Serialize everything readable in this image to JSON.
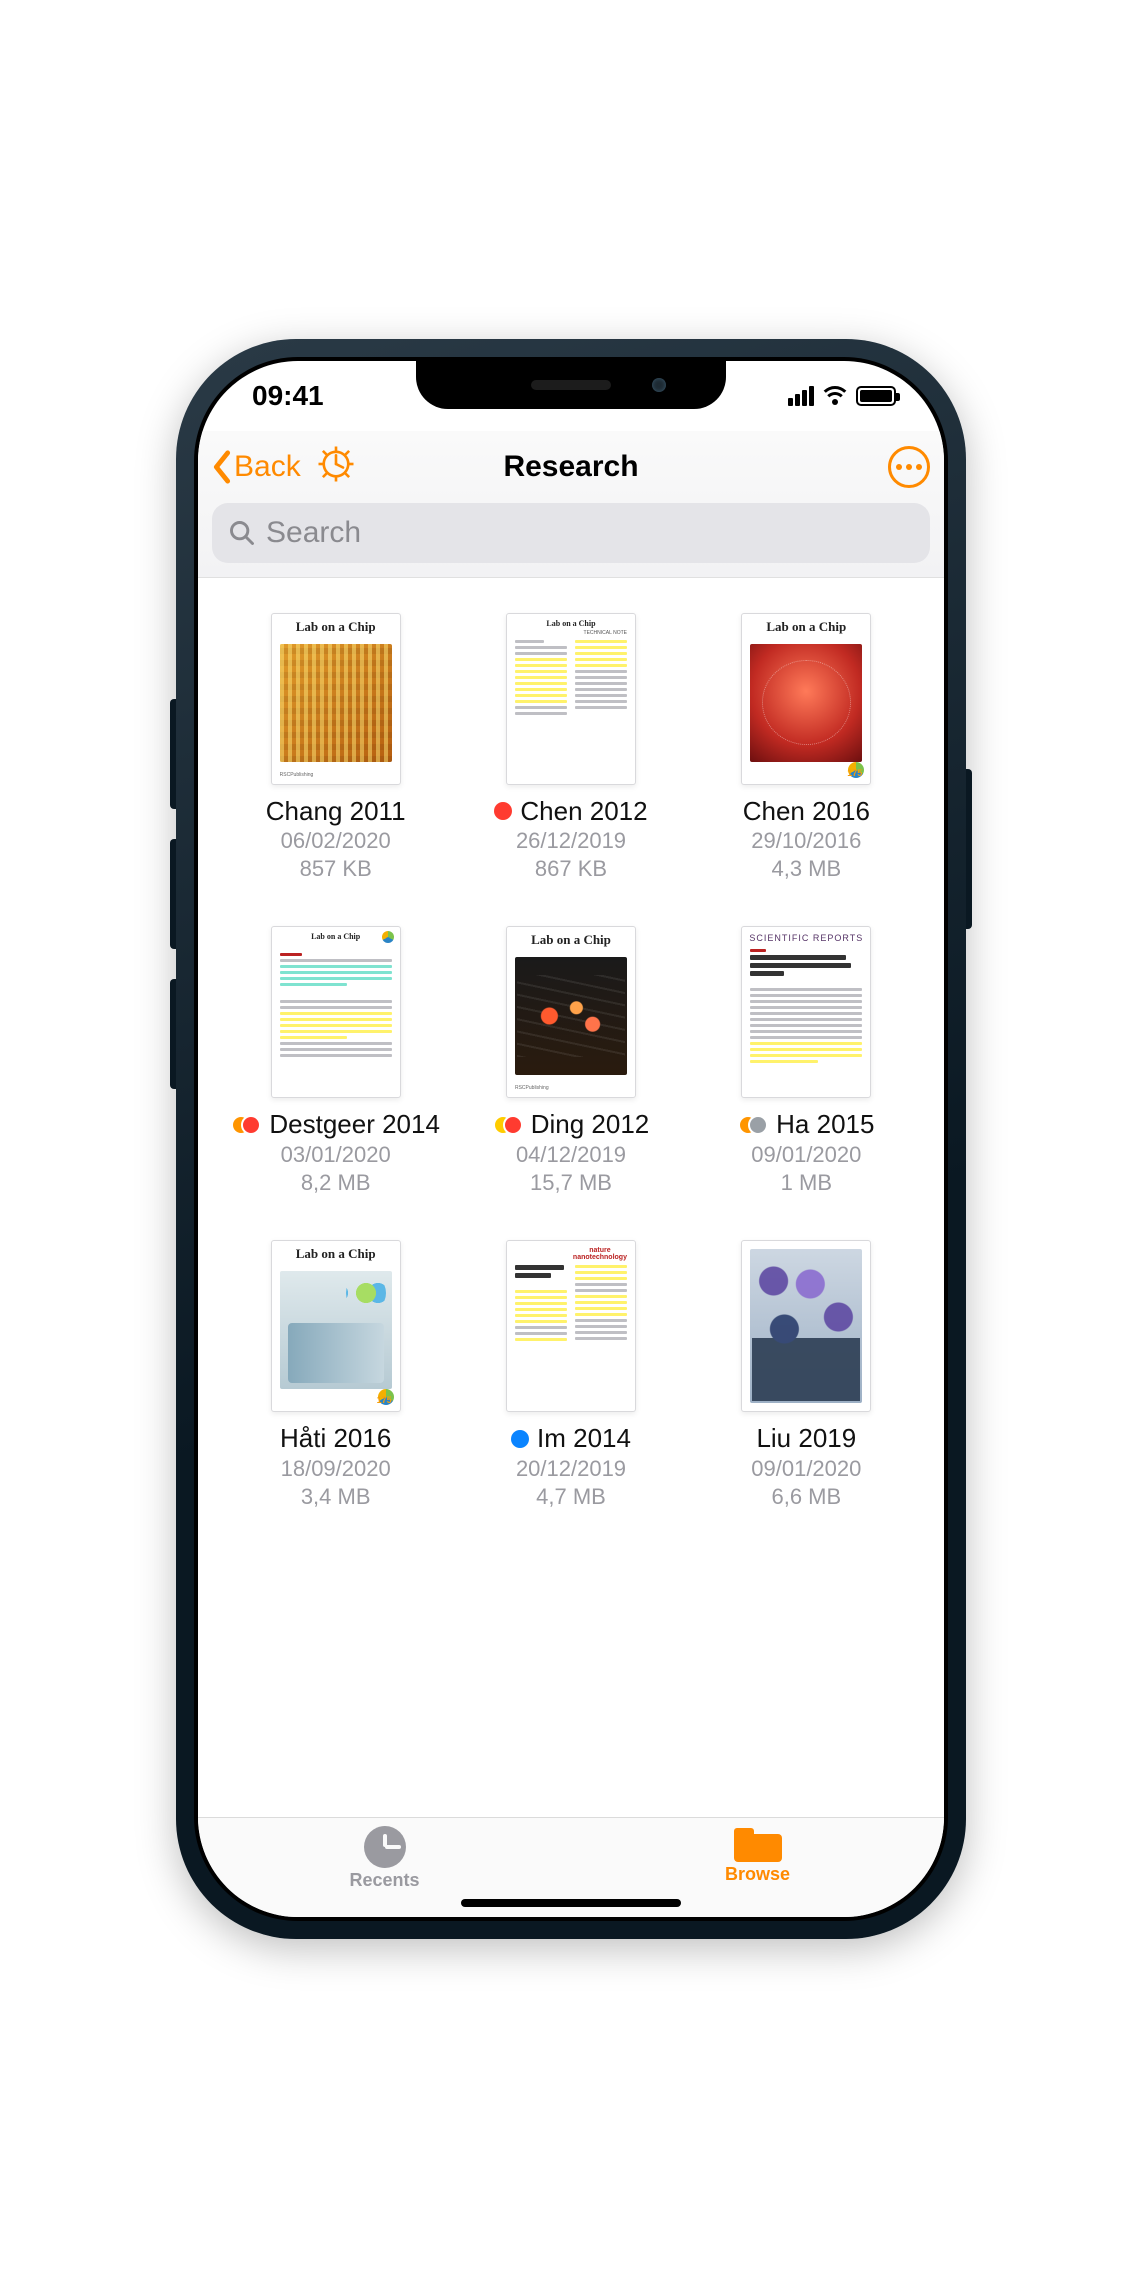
{
  "status": {
    "time": "09:41"
  },
  "nav": {
    "back_label": "Back",
    "title": "Research"
  },
  "search": {
    "placeholder": "Search"
  },
  "documents": [
    {
      "title": "Chang 2011",
      "date": "06/02/2020",
      "size": "857 KB",
      "tags": [],
      "thumb": {
        "kind": "cover",
        "journal": "Lab on a Chip",
        "cover": "chang",
        "rsc": true
      }
    },
    {
      "title": "Chen 2012",
      "date": "26/12/2019",
      "size": "867 KB",
      "tags": [
        "red"
      ],
      "thumb": {
        "kind": "text",
        "journal": "Lab on a Chip",
        "note": "TECHNICAL NOTE",
        "highlights": "yellow-block"
      }
    },
    {
      "title": "Chen 2016",
      "date": "29/10/2016",
      "size": "4,3 MB",
      "tags": [],
      "thumb": {
        "kind": "cover",
        "journal": "Lab on a Chip",
        "cover": "chen16",
        "badge": "175"
      }
    },
    {
      "title": "Destgeer 2014",
      "date": "03/01/2020",
      "size": "8,2 MB",
      "tags": [
        "orange",
        "red"
      ],
      "thumb": {
        "kind": "text",
        "journal": "Lab on a Chip",
        "highlights": "mixed"
      }
    },
    {
      "title": "Ding 2012",
      "date": "04/12/2019",
      "size": "15,7 MB",
      "tags": [
        "yellow",
        "red"
      ],
      "thumb": {
        "kind": "cover",
        "journal": "Lab on a Chip",
        "cover": "ding"
      }
    },
    {
      "title": "Ha 2015",
      "date": "09/01/2020",
      "size": "1 MB",
      "tags": [
        "orange",
        "grey"
      ],
      "thumb": {
        "kind": "text",
        "journal": "SCIENTIFIC REPORTS",
        "header": "Acoustothermal heating of polydimethylsiloxane microfluidic system",
        "highlights": "yellow-bottom"
      }
    },
    {
      "title": "Håti 2016",
      "date": "18/09/2020",
      "size": "3,4 MB",
      "tags": [],
      "thumb": {
        "kind": "cover",
        "journal": "Lab on a Chip",
        "cover": "hati",
        "badge": "175"
      }
    },
    {
      "title": "Im 2014",
      "date": "20/12/2019",
      "size": "4,7 MB",
      "tags": [
        "blue"
      ],
      "thumb": {
        "kind": "text",
        "journal": "nature nanotechnology",
        "header": "Label-free detection and molecular profiling of exosomes with a nano-plasmonic sensor",
        "highlights": "yellow-heavy"
      }
    },
    {
      "title": "Liu 2019",
      "date": "09/01/2020",
      "size": "6,6 MB",
      "tags": [],
      "thumb": {
        "kind": "cover",
        "journal": "",
        "cover": "liu"
      }
    }
  ],
  "tabs": {
    "recents": "Recents",
    "browse": "Browse",
    "active": "browse"
  }
}
